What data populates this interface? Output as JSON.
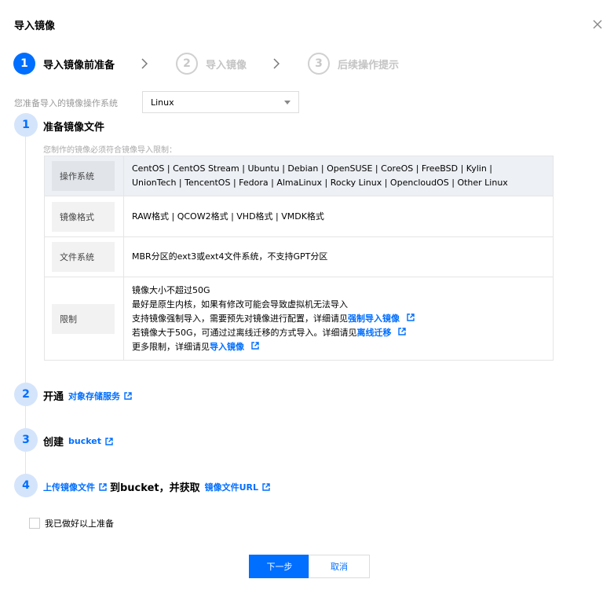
{
  "dialog": {
    "title": "导入镜像"
  },
  "steps": [
    {
      "num": "1",
      "label": "导入镜像前准备",
      "active": true
    },
    {
      "num": "2",
      "label": "导入镜像",
      "active": false
    },
    {
      "num": "3",
      "label": "后续操作提示",
      "active": false
    }
  ],
  "os": {
    "label": "您准备导入的镜像操作系统",
    "value": "Linux"
  },
  "sections": {
    "s1": {
      "num": "1",
      "title": "准备镜像文件",
      "hint": "您制作的镜像必须符合镜像导入限制："
    },
    "s2": {
      "num": "2",
      "prefix": "开通",
      "link": "对象存储服务"
    },
    "s3": {
      "num": "3",
      "prefix": "创建",
      "link": "bucket"
    },
    "s4": {
      "num": "4",
      "link1": "上传镜像文件",
      "middle": "到bucket，并获取",
      "link2": "镜像文件URL"
    }
  },
  "table": {
    "os_key": "操作系统",
    "os_line1": "CentOS | CentOS Stream | Ubuntu | Debian | OpenSUSE | CoreOS | FreeBSD | Kylin |",
    "os_line2": "UnionTech | TencentOS | Fedora | AlmaLinux | Rocky Linux | OpencloudOS | Other Linux",
    "format_key": "镜像格式",
    "format_val": "RAW格式 | QCOW2格式 | VHD格式 | VMDK格式",
    "fs_key": "文件系统",
    "fs_val": "MBR分区的ext3或ext4文件系统，不支持GPT分区",
    "limit_key": "限制",
    "limit_l1": "镜像大小不超过50G",
    "limit_l2": "最好是原生内核，如果有修改可能会导致虚拟机无法导入",
    "limit_l3": "支持镜像强制导入，需要预先对镜像进行配置，详细请见",
    "limit_l3_link": "强制导入镜像",
    "limit_l4": "若镜像大于50G，可通过过离线迁移的方式导入。详细请见",
    "limit_l4_link": "离线迁移",
    "limit_l5": "更多限制，详细请见",
    "limit_l5_link": "导入镜像"
  },
  "checkbox": {
    "label": "我已做好以上准备",
    "checked": false
  },
  "buttons": {
    "next": "下一步",
    "cancel": "取消"
  },
  "colors": {
    "primary": "#006eff",
    "circle_bg": "#d4e4fb",
    "highlight_row": "#edf0f4"
  }
}
